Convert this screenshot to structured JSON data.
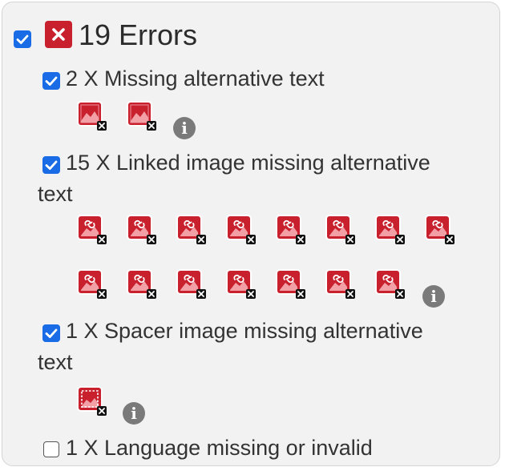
{
  "summary": {
    "count_label": "19 Errors",
    "checked": true
  },
  "groups": [
    {
      "id": "missing-alt",
      "label": "2 X Missing alternative text",
      "checked": true,
      "icon": "image-error-icon",
      "count": 2
    },
    {
      "id": "linked-image",
      "label_line1": "15 X Linked image missing alternative",
      "label_line2": "text",
      "checked": true,
      "icon": "linked-image-error-icon",
      "count": 15
    },
    {
      "id": "spacer-image",
      "label_line1": "1 X Spacer image missing alternative",
      "label_line2": "text",
      "checked": true,
      "icon": "spacer-image-error-icon",
      "count": 1
    },
    {
      "id": "language",
      "label": "1 X Language missing or invalid",
      "checked": false
    }
  ],
  "info_label": "i",
  "colors": {
    "error_red": "#c8202d",
    "checkbox_blue": "#1a6ce6",
    "panel_bg": "#f2f2f2",
    "info_grey": "#7a7a7a"
  }
}
